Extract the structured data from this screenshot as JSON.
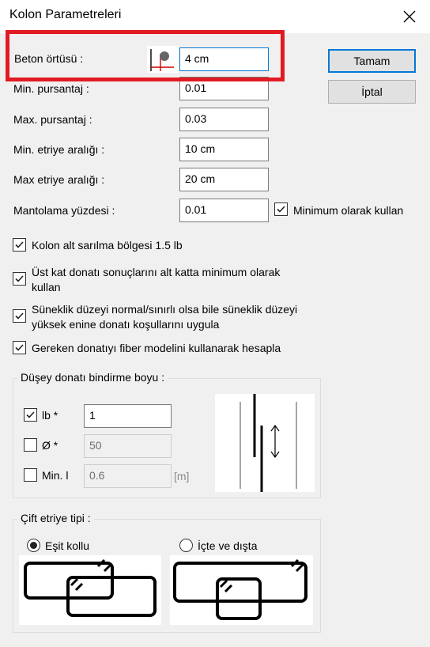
{
  "window": {
    "title": "Kolon Parametreleri"
  },
  "labels": {
    "beton_ortusu": "Beton örtüsü :",
    "min_pursantaj": "Min.  pursantaj :",
    "max_pursantaj": "Max. pursantaj :",
    "min_etriye": "Min. etriye aralığı :",
    "max_etriye": "Max etriye aralığı :",
    "mantolama": "Mantolama yüzdesi :"
  },
  "fields": {
    "beton_ortusu": "4 cm",
    "min_pursantaj": "0.01",
    "max_pursantaj": "0.03",
    "min_etriye": "10 cm",
    "max_etriye": "20 cm",
    "mantolama": "0.01"
  },
  "buttons": {
    "ok": "Tamam",
    "cancel": "İptal"
  },
  "checks": {
    "minimum_kullan": {
      "label": "Minimum olarak kullan",
      "checked": true
    },
    "kolon_alt": {
      "label": "Kolon alt sarılma bölgesi 1.5 lb",
      "checked": true
    },
    "ust_kat_1": "Üst kat donatı sonuçlarını alt katta minimum olarak",
    "ust_kat_2": "kullan",
    "suneklik_1": "Süneklik düzeyi normal/sınırlı olsa bile süneklik düzeyi",
    "suneklik_2": "yüksek enine donatı koşullarını uygula",
    "fiber": "Gereken donatıyı fiber modelini kullanarak hesapla"
  },
  "bindirme": {
    "title": "Düşey donatı bindirme boyu :",
    "lb_label": "lb *",
    "lb_value": "1",
    "lb_checked": true,
    "phi_label": "Ø *",
    "phi_value": "50",
    "phi_checked": false,
    "minl_label": "Min. l",
    "minl_value": "0.6",
    "minl_checked": false,
    "unit": "[m]"
  },
  "etriye": {
    "title": "Çift etriye tipi :",
    "option1": "Eşit kollu",
    "option2": "İçte ve dışta",
    "selected": "Eşit kollu"
  },
  "colors": {
    "accent": "#0078d7",
    "highlight": "#e21a23"
  }
}
